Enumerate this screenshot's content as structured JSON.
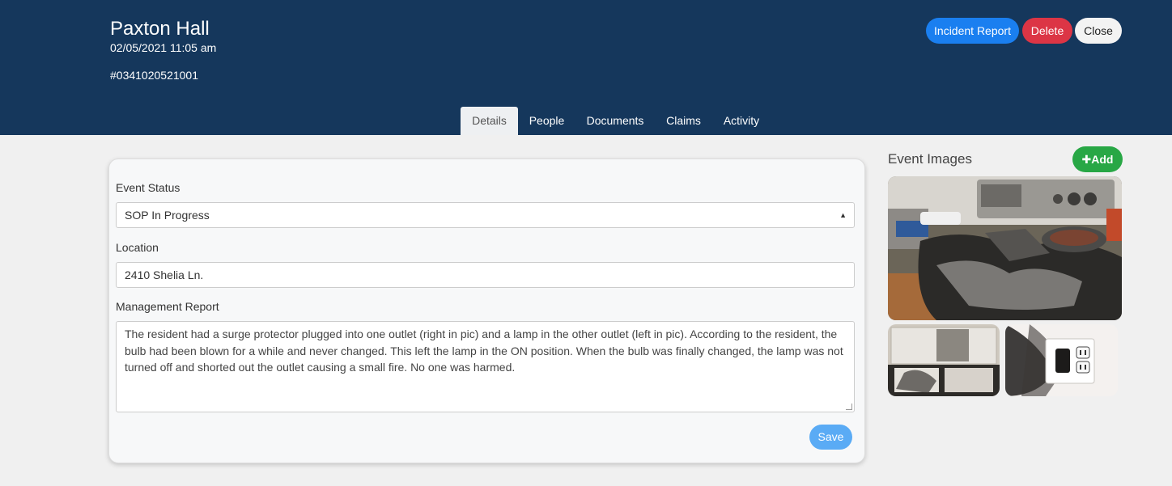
{
  "header": {
    "title": "Paxton Hall",
    "datetime": "02/05/2021 11:05 am",
    "event_id": "#0341020521001",
    "buttons": {
      "incident_report": "Incident Report",
      "delete": "Delete",
      "close": "Close"
    }
  },
  "tabs": [
    {
      "label": "Details",
      "active": true
    },
    {
      "label": "People",
      "active": false
    },
    {
      "label": "Documents",
      "active": false
    },
    {
      "label": "Claims",
      "active": false
    },
    {
      "label": "Activity",
      "active": false
    }
  ],
  "form": {
    "event_status_label": "Event Status",
    "event_status_value": "SOP In Progress",
    "location_label": "Location",
    "location_value": "2410 Shelia Ln.",
    "management_report_label": "Management Report",
    "management_report_value": "The resident had a surge protector plugged into one outlet (right in pic) and a lamp in the other outlet (left in pic). According to the resident, the bulb had been blown for a while and never changed. This left the lamp in the ON position. When the bulb was finally changed, the lamp was not turned off and shorted out the outlet causing a small fire. No one was harmed.",
    "save_label": "Save"
  },
  "images_panel": {
    "title": "Event Images",
    "add_label": "Add",
    "add_icon": "plus-icon"
  },
  "colors": {
    "header_bg": "#15375c",
    "primary": "#1a7ff0",
    "danger": "#dc3545",
    "success": "#28a745",
    "save": "#5aabf5"
  }
}
